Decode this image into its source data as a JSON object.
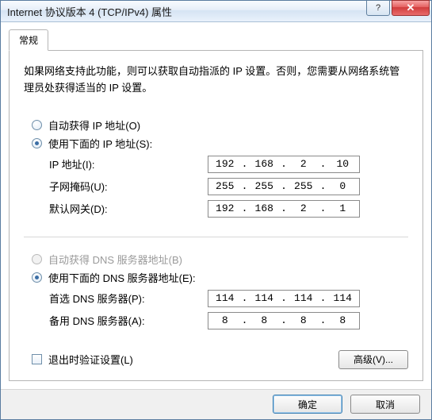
{
  "window": {
    "title": "Internet 协议版本 4 (TCP/IPv4) 属性",
    "help_label": "?",
    "close_label": "✕"
  },
  "tab": {
    "general": "常规"
  },
  "description": "如果网络支持此功能，则可以获取自动指派的 IP 设置。否则，您需要从网络系统管理员处获得适当的 IP 设置。",
  "ip_group": {
    "auto_label": "自动获得 IP 地址(O)",
    "manual_label": "使用下面的 IP 地址(S):",
    "ip_label": "IP 地址(I):",
    "mask_label": "子网掩码(U):",
    "gateway_label": "默认网关(D):",
    "ip": {
      "a": "192",
      "b": "168",
      "c": "2",
      "d": "10"
    },
    "mask": {
      "a": "255",
      "b": "255",
      "c": "255",
      "d": "0"
    },
    "gateway": {
      "a": "192",
      "b": "168",
      "c": "2",
      "d": "1"
    }
  },
  "dns_group": {
    "auto_label": "自动获得 DNS 服务器地址(B)",
    "manual_label": "使用下面的 DNS 服务器地址(E):",
    "primary_label": "首选 DNS 服务器(P):",
    "alt_label": "备用 DNS 服务器(A):",
    "primary": {
      "a": "114",
      "b": "114",
      "c": "114",
      "d": "114"
    },
    "alt": {
      "a": "8",
      "b": "8",
      "c": "8",
      "d": "8"
    }
  },
  "validate_label": "退出时验证设置(L)",
  "advanced_label": "高级(V)...",
  "ok_label": "确定",
  "cancel_label": "取消"
}
